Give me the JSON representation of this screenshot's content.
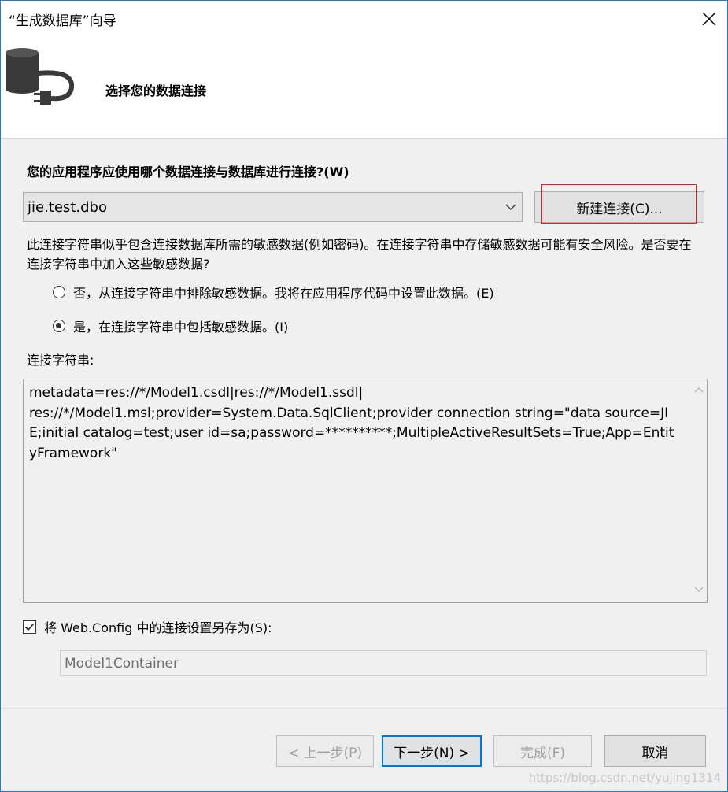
{
  "window": {
    "title": "“生成数据库”向导"
  },
  "header": {
    "heading": "选择您的数据连接",
    "icon": "database-plug-icon"
  },
  "connection": {
    "question": "您的应用程序应使用哪个数据连接与数据库进行连接?(W)",
    "selected": "jie.test.dbo",
    "new_connection_label": "新建连接(C)..."
  },
  "sensitive": {
    "warning": "此连接字符串似乎包含连接数据库所需的敏感数据(例如密码)。在连接字符串中存储敏感数据可能有安全风险。是否要在连接字符串中加入这些敏感数据?",
    "options": [
      {
        "label": "否，从连接字符串中排除敏感数据。我将在应用程序代码中设置此数据。(E)",
        "checked": false
      },
      {
        "label": "是，在连接字符串中包括敏感数据。(I)",
        "checked": true
      }
    ]
  },
  "connection_string": {
    "label": "连接字符串:",
    "value": "metadata=res://*/Model1.csdl|res://*/Model1.ssdl|\nres://*/Model1.msl;provider=System.Data.SqlClient;provider connection string=\"data source=JIE;initial catalog=test;user id=sa;password=**********;MultipleActiveResultSets=True;App=EntityFramework\""
  },
  "save_config": {
    "label": "将 Web.Config 中的连接设置另存为(S):",
    "checked": true,
    "value": "Model1Container"
  },
  "buttons": {
    "back": "< 上一步(P)",
    "next": "下一步(N) >",
    "finish": "完成(F)",
    "cancel": "取消"
  },
  "watermark": "https://blog.csdn.net/yujing1314",
  "colors": {
    "accent": "#0078d7",
    "highlight": "#e02020"
  }
}
